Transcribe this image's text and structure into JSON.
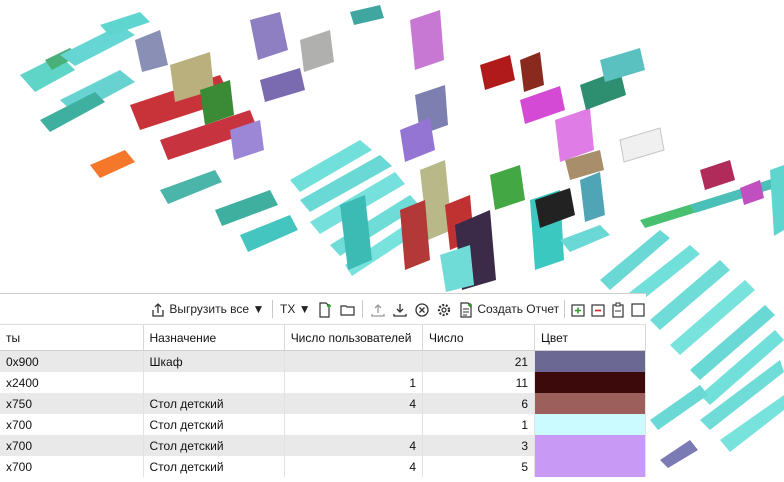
{
  "toolbar": {
    "export_all_label": "Выгрузить все",
    "tx_label": "TX",
    "create_report_label": "Создать Отчет"
  },
  "table": {
    "columns": [
      "ты",
      "Назначение",
      "Число пользователей",
      "Число",
      "Цвет"
    ],
    "rows": [
      {
        "size": "0x900",
        "purpose": "Шкаф",
        "users": "",
        "count": "21",
        "color": "#6b6894"
      },
      {
        "size": "x2400",
        "purpose": "",
        "users": "1",
        "count": "11",
        "color": "#3c0a0a"
      },
      {
        "size": "x750",
        "purpose": "Стол детский",
        "users": "4",
        "count": "6",
        "color": "#9d5f5b"
      },
      {
        "size": "x700",
        "purpose": "Стол детский",
        "users": "",
        "count": "1",
        "color": "#ccfbff"
      },
      {
        "size": "x700",
        "purpose": "Стол детский",
        "users": "4",
        "count": "3",
        "color": "#c99af5"
      },
      {
        "size": "x700",
        "purpose": "Стол детский",
        "users": "4",
        "count": "5",
        "color": "#c99af5"
      }
    ]
  }
}
